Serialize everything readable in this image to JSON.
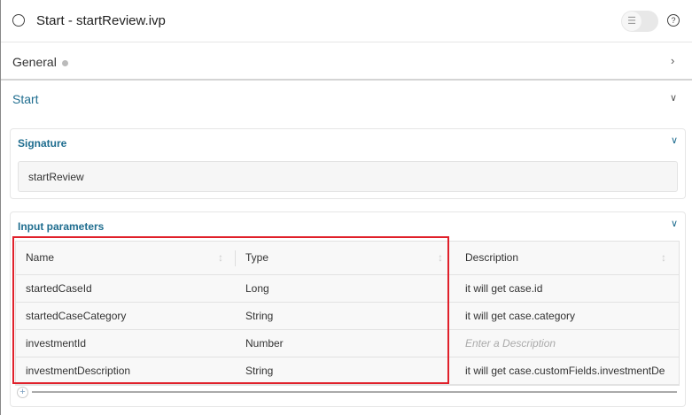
{
  "header": {
    "title": "Start - startReview.ivp",
    "toggle_icon": "list-icon",
    "help_icon": "help-icon"
  },
  "general": {
    "label": "General"
  },
  "section": {
    "title": "Start"
  },
  "signature": {
    "title": "Signature",
    "value": "startReview"
  },
  "input_parameters": {
    "title": "Input parameters",
    "columns": [
      "Name",
      "Type",
      "Description"
    ],
    "rows": [
      {
        "name": "startedCaseId",
        "type": "Long",
        "description": "it will get case.id"
      },
      {
        "name": "startedCaseCategory",
        "type": "String",
        "description": "it will get case.category"
      },
      {
        "name": "investmentId",
        "type": "Number",
        "description": "",
        "description_placeholder": "Enter a Description"
      },
      {
        "name": "investmentDescription",
        "type": "String",
        "description": "it will get case.customFields.investmentDe"
      }
    ]
  },
  "colors": {
    "accent": "#1f6d8f",
    "highlight": "#e0202a"
  }
}
